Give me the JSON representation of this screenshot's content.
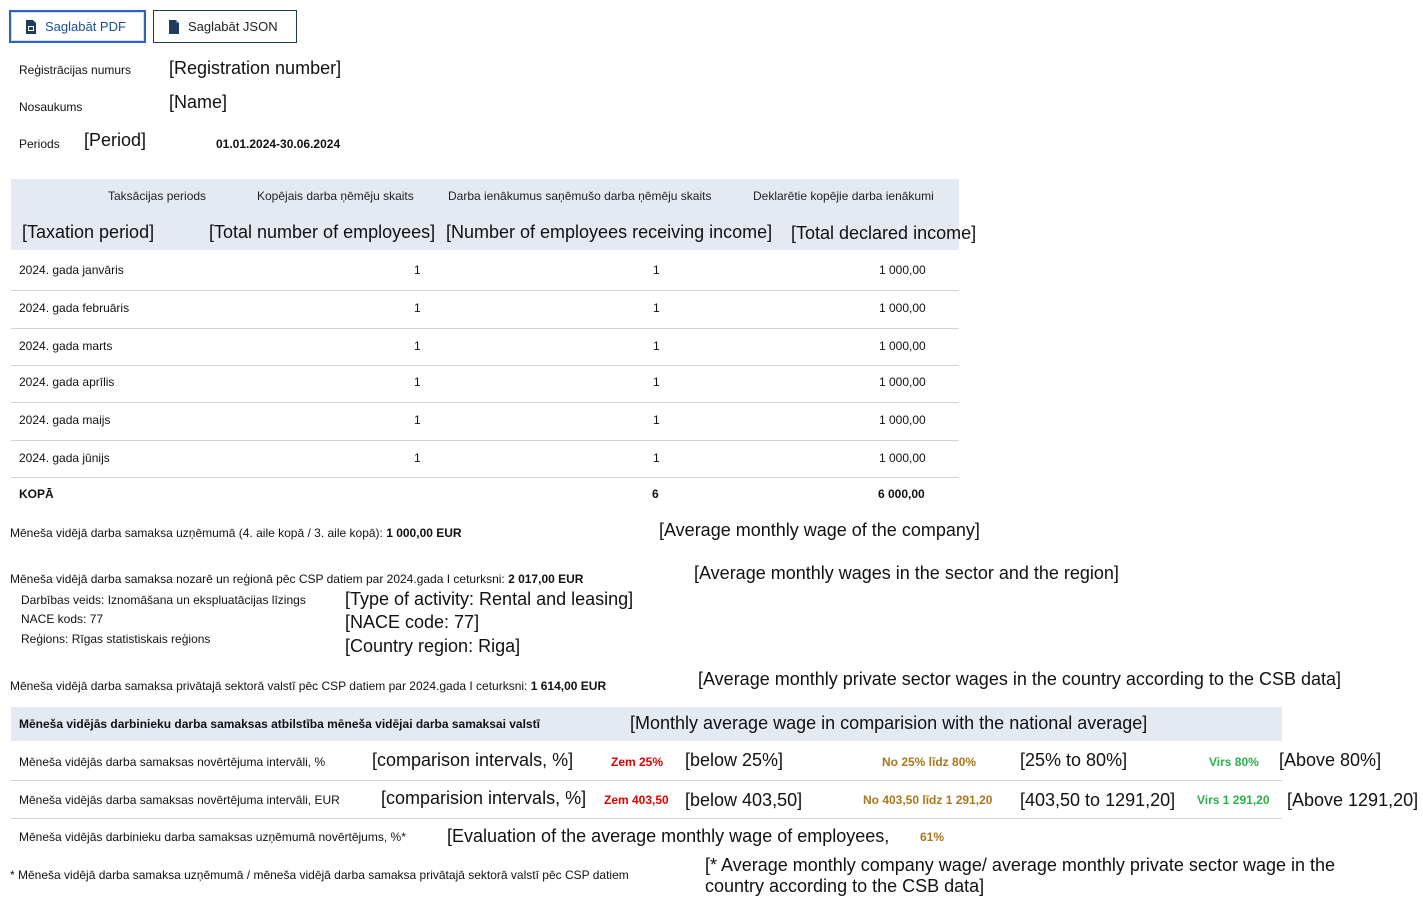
{
  "buttons": {
    "pdf_label": "Saglabāt PDF",
    "json_label": "Saglabāt JSON"
  },
  "info": {
    "reg_label": "Reģistrācijas numurs",
    "reg_ann": "[Registration number]",
    "name_label": "Nosaukums",
    "name_ann": "[Name]",
    "period_label": "Periods",
    "period_ann": "[Period]",
    "period_value": "01.01.2024-30.06.2024"
  },
  "table": {
    "headers": [
      "Taksācijas periods",
      "Kopējais darba ņēmēju skaits",
      "Darba ienākumus saņēmušo darba ņēmēju skaits",
      "Deklarētie kopējie darba ienākumi"
    ],
    "header_ann": [
      "[Taxation period]",
      "[Total number of employees]",
      "[Number of employees receiving income]",
      "[Total declared income]"
    ],
    "rows": [
      [
        "2024. gada janvāris",
        "1",
        "1",
        "1 000,00"
      ],
      [
        "2024. gada februāris",
        "1",
        "1",
        "1 000,00"
      ],
      [
        "2024. gada marts",
        "1",
        "1",
        "1 000,00"
      ],
      [
        "2024. gada aprīlis",
        "1",
        "1",
        "1 000,00"
      ],
      [
        "2024. gada maijs",
        "1",
        "1",
        "1 000,00"
      ],
      [
        "2024. gada jūnijs",
        "1",
        "1",
        "1 000,00"
      ]
    ],
    "total": [
      "KOPĀ",
      "",
      "6",
      "6 000,00"
    ]
  },
  "avg_company": {
    "text": "Mēneša vidējā darba samaksa uzņēmumā (4. aile kopā / 3. aile kopā): ",
    "value": "1 000,00 EUR",
    "ann": "[Average monthly wage of the company]"
  },
  "avg_sector": {
    "text": "Mēneša vidējā darba samaksa nozarē un reģionā pēc CSP datiem par 2024.gada I ceturksni: ",
    "value": "2 017,00 EUR",
    "ann": "[Average monthly wages in the sector and the region]",
    "activity": "Darbības veids: Iznomāšana un ekspluatācijas līzings",
    "activity_ann": "[Type of activity: Rental and leasing]",
    "nace": "NACE kods: 77",
    "nace_ann": "[NACE code: 77]",
    "region": "Reģions: Rīgas statistiskais reģions",
    "region_ann": "[Country region: Riga]"
  },
  "avg_private": {
    "text": "Mēneša vidējā darba samaksa privātajā sektorā valstī pēc CSP datiem par 2024.gada I ceturksni: ",
    "value": "1 614,00 EUR",
    "ann": "[Average monthly private sector wages in the country according to the CSB data]"
  },
  "comparison": {
    "title": "Mēneša vidējās darbinieku darba samaksas atbilstība mēneša vidējai darba samaksai valstī",
    "title_ann": "[Monthly average wage in comparision with the national average]",
    "pct_label": "Mēneša vidējās darba samaksas novērtējuma intervāli, %",
    "pct_ann": "[comparison intervals, %]",
    "pct_low": "Zem 25%",
    "pct_low_ann": "[below 25%]",
    "pct_mid": "No 25% līdz 80%",
    "pct_mid_ann": "[25% to 80%]",
    "pct_high": "Virs 80%",
    "pct_high_ann": "[Above 80%]",
    "eur_label": "Mēneša vidējās darba samaksas novērtējuma intervāli, EUR",
    "eur_ann": "[comparision intervals, %]",
    "eur_low": "Zem 403,50",
    "eur_low_ann": "[below 403,50]",
    "eur_mid": "No 403,50 līdz 1 291,20",
    "eur_mid_ann": "[403,50 to 1291,20]",
    "eur_high": "Virs 1 291,20",
    "eur_high_ann": "[Above 1291,20]",
    "eval_label": "Mēneša vidējās darbinieku darba samaksas uzņēmumā novērtējums, %*",
    "eval_ann": "[Evaluation of the average monthly wage of employees,",
    "eval_value": "61%"
  },
  "footnote": {
    "text": "* Mēneša vidējā darba samaksa uzņēmumā / mēneša vidējā darba samaksa privātajā sektorā valstī pēc CSP datiem",
    "ann_line1": "[* Average monthly company wage/ average monthly private sector wage in the",
    "ann_line2": "country according to the CSB data]"
  },
  "colors": {
    "low": "#e00000",
    "mid": "#a8781c",
    "high": "#2ab24a",
    "header_bg": "#e4e9f2"
  }
}
